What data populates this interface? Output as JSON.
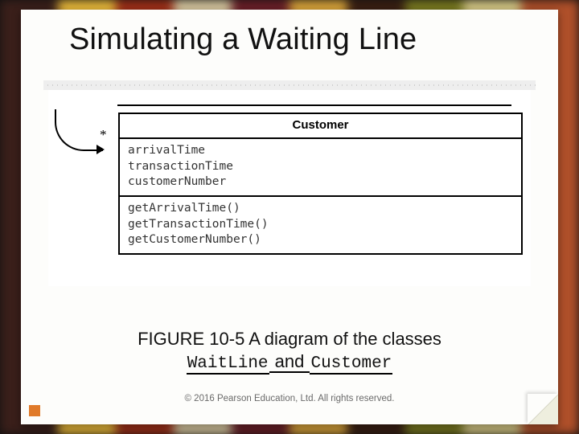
{
  "title": "Simulating a Waiting Line",
  "diagram": {
    "multiplicity": "*",
    "class_name": "Customer",
    "attributes": [
      "arrivalTime",
      "transactionTime",
      "customerNumber"
    ],
    "operations": [
      "getArrivalTime()",
      "getTransactionTime()",
      "getCustomerNumber()"
    ]
  },
  "caption": {
    "prefix": "FIGURE 10-5 A diagram of the classes",
    "class_a": "WaitLine",
    "joiner": " and ",
    "class_b": "Customer"
  },
  "copyright": "© 2016 Pearson Education, Ltd.  All rights reserved."
}
